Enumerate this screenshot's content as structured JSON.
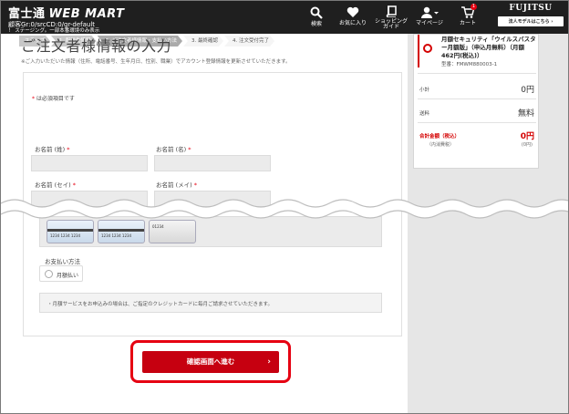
{
  "header": {
    "brand_line1": "富士通",
    "brand_name": "WEB MART",
    "brand_line2": "顧客Gr:0/srcCD:0/gr-default",
    "brand_line3": "！ ステージング。一部本番環境のみ表示",
    "nav": [
      {
        "icon": "search-icon",
        "label": "検索"
      },
      {
        "icon": "heart-icon",
        "label": "お気に入り"
      },
      {
        "icon": "book-icon",
        "label": "ショッピング\nガイド"
      },
      {
        "icon": "user-icon",
        "label": "マイページ"
      },
      {
        "icon": "cart-icon",
        "label": "カート",
        "badge": "1"
      }
    ],
    "logo": "FUJITSU",
    "model_button": "法人モデルはこちら ›"
  },
  "steps": [
    {
      "label": "ステップ",
      "state": "done"
    },
    {
      "label": "1. 配送先情報",
      "state": "done"
    },
    {
      "label": "2. ご注文者様情報・支払い方法",
      "state": "active"
    },
    {
      "label": "3. 最終確認",
      "state": "todo"
    },
    {
      "label": "4. 注文受付完了",
      "state": "todo"
    }
  ],
  "page": {
    "title": "ご注文者様情報の入力",
    "note": "※ご入力いただいた情報（住所、電話番号、生年月日、性別、職業）でアカウント登録情報を更新させていただきます。",
    "required_note": "* は必須項目です",
    "fields": {
      "last_name": "お名前 (姓)",
      "first_name": "お名前 (名)",
      "last_kana": "お名前 (セイ)",
      "first_kana": "お名前 (メイ)"
    },
    "required_mark": "*",
    "card_labels": [
      "1234 1234 1234",
      "1234 1234 1234",
      "01234"
    ],
    "payment_label": "お支払い方法",
    "payment_option": "月額払い",
    "monthly_note": "・月額サービスをお申込みの場合は、ご指定のクレジットカードに毎月ご請求させていただきます。",
    "confirm_button": "確認画面へ進む"
  },
  "summary": {
    "product": "月額セキュリティ「ウイルスバスター月額版」（申込月無料）（月額462円(税込)）",
    "model": "型番：FMWM880003-1",
    "subtotal_label": "小計",
    "subtotal_value": "0円",
    "shipping_label": "送料",
    "shipping_value": "無料",
    "total_label": "合計金額（税込）",
    "total_value": "0円",
    "tax_label": "（内消費税）",
    "tax_value": "(0円)"
  },
  "colors": {
    "header_bg": "#1f1f1f",
    "accent_red": "#c60010",
    "highlight_red": "#e60012"
  }
}
